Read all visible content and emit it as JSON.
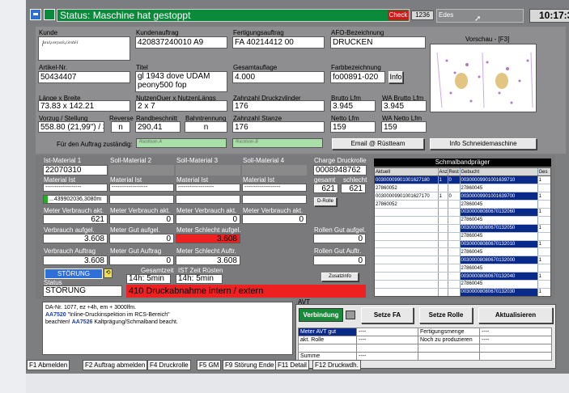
{
  "header": {
    "title": "Status: Maschine hat gestoppt",
    "check_label": "Check",
    "check_count": "1236",
    "user": "Edes",
    "time": "10:17:39"
  },
  "order": {
    "kunde_label": "Kunde",
    "kundenauftrag_label": "Kundenauftrag",
    "kundenauftrag_value": "420837240010   A9",
    "fertigungsauftrag_label": "Fertigungsauftrag",
    "fertigungsauftrag_value": "FA 40214412 00",
    "afo_label": "AFO-Bezeichnung",
    "afo_value": "DRUCKEN",
    "vorschau_label": "Vorschau - [F3]",
    "artikel_label": "Artikel-Nr.",
    "artikel_value": "50434407",
    "titel_label": "Titel",
    "titel_value": "gl 1943 dove UDAM peony500 fop",
    "gesamtauflage_label": "Gesamtauflage",
    "gesamtauflage_value": "4.000",
    "farbbezeichnung_label": "Farbbezeichnung",
    "farbbezeichnung_value": "fo00891-020",
    "info_button": "Info",
    "laenge_label": "Länge x Breite",
    "laenge_value": "73.83 x 142.21",
    "nutzen_label": "NutzenQuer x NutzenLängs",
    "nutzen_value": "2 x 7",
    "zahnzahl_zyl_label": "Zahnzahl Druckzylinder",
    "zahnzahl_zyl_value": "176",
    "brutto_label": "Brutto Lfm",
    "brutto_value": "3.945",
    "wa_brutto_label": "WA Brutto Lfm",
    "wa_brutto_value": "3.945",
    "vorzug_label": "Vorzug / Stellung",
    "vorzug_value": "558.80 (21,99\") / 3",
    "reverse_label": "Reverse",
    "reverse_value": "n",
    "randbeschnitt_label": "Randbeschnitt",
    "randbeschnitt_value": "290,41",
    "bahntrennung_label": "Bahntrennung",
    "bahntrennung_value": "n",
    "zahnzahl_stanze_label": "Zahnzahl Stanze",
    "zahnzahl_stanze_value": "176",
    "netto_label": "Netto Lfm",
    "netto_value": "159",
    "wa_netto_label": "WA Netto Lfm",
    "wa_netto_value": "159",
    "zustaendig_label": "Für den Auftrag zuständig:",
    "email_button": "Email @ Rüstteam",
    "schneide_button": "Info Schneidemaschine"
  },
  "material": {
    "ist1_label": "Ist-Material 1",
    "ist1_value": "22070310",
    "soll2_label": "Soll-Material 2",
    "soll3_label": "Soll-Material 3",
    "soll4_label": "Soll-Material 4",
    "material_ist_label": "Material Ist",
    "dashes": "-------------------",
    "progress_text": "...439902036,3080m",
    "meter_verbrauch_akt_label": "Meter Verbrauch akt.",
    "meter_verbrauch_akt_1": "621",
    "meter_verbrauch_akt_2": "0",
    "meter_verbrauch_akt_3": "0",
    "meter_verbrauch_akt_4": "0",
    "verbrauch_aufgel_label": "Verbrauch aufgel.",
    "verbrauch_aufgel_value": "3.608",
    "meter_gut_aufgel_label": "Meter Gut aufgel.",
    "meter_gut_aufgel_value": "0",
    "meter_schlecht_aufgel_label": "Meter Schlecht aufgel.",
    "meter_schlecht_aufgel_value": "3.608",
    "verbrauch_auftr_label": "Verbrauch Auftrag",
    "verbrauch_auftr_value": "3.608",
    "meter_gut_auftr_label": "Meter Gut Auftrag",
    "meter_gut_auftr_value": "0",
    "meter_schlecht_auftr_label": "Meter Schlecht Auftr.",
    "meter_schlecht_auftr_value": "3.608",
    "stoerung_button": "STÖRUNG",
    "gesamtzeit_label": "Gesamtzeit",
    "gesamtzeit_value": "14h: 5min",
    "ist_zeit_label": "IST Zeit Rüsten",
    "ist_zeit_value": "14h: 5min",
    "status_label": "Status",
    "status_value": "STÖRUNG",
    "alarm_text": "410 Druckabnahme intern / extern"
  },
  "charge": {
    "charge_label": "Charge Druckrolle",
    "charge_value": "0008948762",
    "gesamt_label": "gesamt",
    "schlecht_label": "schlecht",
    "gesamt_value": "621",
    "schlecht_value": "621",
    "drolle_button": "D-Rolle",
    "rollen_gut_aufgel_label": "Rollen Gut aufgel.",
    "rollen_gut_aufgel_value": "0",
    "rollen_gut_auftr_label": "Rollen Gut Auftr.",
    "rollen_gut_auftr_value": "0",
    "zusatzinfo_button": "Zusatzinfo"
  },
  "schmalband": {
    "title": "Schmalbandpräger",
    "headers": [
      "Aktuell",
      "Anz",
      "Rest",
      "Gebucht",
      "Ges"
    ],
    "rows": [
      [
        "00300009901001627180",
        "1",
        "0",
        "00300009901001639710",
        "1"
      ],
      [
        "27860052",
        "",
        "",
        "27860045",
        ""
      ],
      [
        "00300009901001627170",
        "1",
        "0",
        "00300009901001639700",
        "1"
      ],
      [
        "27860052",
        "",
        "",
        "27860045",
        ""
      ],
      [
        "",
        "",
        "",
        "00300008080670132060",
        "1"
      ],
      [
        "",
        "",
        "",
        "27860045",
        ""
      ],
      [
        "",
        "",
        "",
        "00300008080670132050",
        "1"
      ],
      [
        "",
        "",
        "",
        "27860045",
        ""
      ],
      [
        "",
        "",
        "",
        "00300008080670132010",
        "1"
      ],
      [
        "",
        "",
        "",
        "27860045",
        ""
      ],
      [
        "",
        "",
        "",
        "00300008080670132000",
        "1"
      ],
      [
        "",
        "",
        "",
        "27860045",
        ""
      ],
      [
        "",
        "",
        "",
        "00300008080670132040",
        "1"
      ],
      [
        "",
        "",
        "",
        "27860045",
        ""
      ],
      [
        "",
        "",
        "",
        "00300008080670132030",
        "1"
      ]
    ]
  },
  "notes": {
    "line1": "DA-Nr. 1077, ez +4h, em + 3000lfm.",
    "line2_code": "AA7520",
    "line2_text": " \"Inline-Druckinspektion im RCS-Bereich\"",
    "line3_pre": "beachten! ",
    "line3_code": "AA7526",
    "line3_text": " Kaltprägung/Schmalband beacht."
  },
  "avt": {
    "label": "AVT",
    "verbindung_button": "Verbindung",
    "setze_fa_button": "Setze FA",
    "setze_rolle_button": "Setze Rolle",
    "aktualisieren_button": "Aktualisieren",
    "meter_avt_gut_label": "Meter AVT gut",
    "akt_rolle_label": "akt. Rolle",
    "summe_label": "Summe",
    "fertigungsmenge_label": "Fertigungsmenge",
    "noch_label": "Noch zu produzieren",
    "dash": "----"
  },
  "fkeys": [
    "F1 Abmelden",
    "F2 Auftrag abmelden",
    "F4 Druckrolle",
    "F5 GM",
    "F9 Störung Ende",
    "F11 Detail",
    "F12 Druckwdh."
  ],
  "colors": {
    "status_bg": "#0a8a3a",
    "panel_top": "#8e8e90",
    "panel_mid": "#7a7a7c",
    "alarm": "#ee2020",
    "check": "#d01818",
    "stoerung": "#2f6fd8",
    "link": "#1a3fb8"
  }
}
